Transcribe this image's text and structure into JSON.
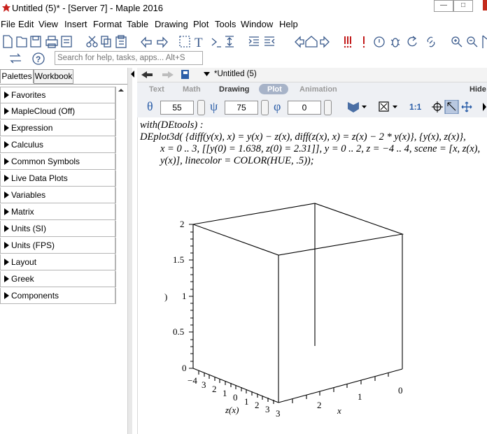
{
  "window": {
    "title": "Untitled (5)* - [Server 7] - Maple 2016",
    "controls": [
      "minimize",
      "maximize"
    ]
  },
  "menu": [
    "File",
    "Edit",
    "View",
    "Insert",
    "Format",
    "Table",
    "Drawing",
    "Plot",
    "Tools",
    "Window",
    "Help"
  ],
  "search": {
    "placeholder": "Search for help, tasks, apps... Alt+S"
  },
  "palettes": {
    "tabs": [
      "Palettes",
      "Workbook"
    ],
    "active_tab": "Palettes",
    "items": [
      "Favorites",
      "MapleCloud (Off)",
      "Expression",
      "Calculus",
      "Common Symbols",
      "Live Data Plots",
      "Variables",
      "Matrix",
      "Units (SI)",
      "Units (FPS)",
      "Layout",
      "Greek",
      "Components"
    ]
  },
  "document": {
    "tab_title": "*Untitled (5)"
  },
  "context_bar": {
    "tabs": [
      "Text",
      "Math",
      "Drawing",
      "Plot",
      "Animation"
    ],
    "active_tab": "Plot",
    "hide_label": "Hide",
    "theta_symbol": "θ",
    "theta_value": "55",
    "psi_symbol": "ψ",
    "psi_value": "75",
    "phi_symbol": "φ",
    "phi_value": "0",
    "ratio_label": "1:1"
  },
  "worksheet": {
    "line1": "with(DEtools) :",
    "line2": "DEplot3d( {diff(y(x), x) = y(x) − z(x), diff(z(x), x) = z(x) − 2 * y(x)}, {y(x), z(x)},",
    "line3": "x = 0 .. 3, [[y(0) = 1.638, z(0) = 2.31]], y = 0 .. 2, z = −4 .. 4, scene = [x, z(x),",
    "line4": "y(x)], linecolor = COLOR(HUE, .5));"
  },
  "plot3d": {
    "vertical_ticks": [
      "2",
      "1.5",
      "1",
      "0.5",
      "0"
    ],
    "vertical_axis_label": ")",
    "z_ticks": [
      "−4",
      "3",
      "2",
      "1",
      "0",
      "1",
      "2",
      "3"
    ],
    "z_axis_label": "z(x)",
    "x_ticks": [
      "3",
      "2",
      "1",
      "0"
    ],
    "x_axis_label": "x"
  }
}
